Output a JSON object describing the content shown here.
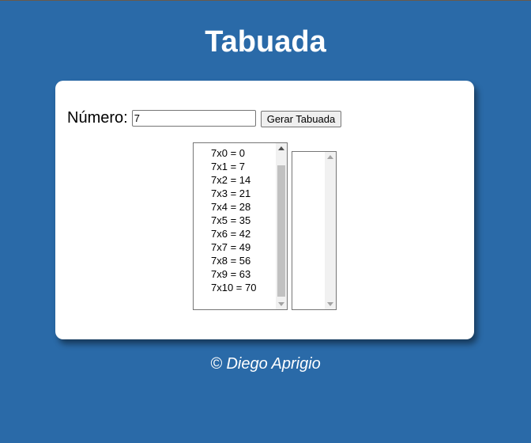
{
  "page": {
    "title": "Tabuada",
    "footer": "© Diego Aprigio"
  },
  "form": {
    "number_label": "Número:",
    "number_value": "7",
    "generate_button": "Gerar Tabuada"
  },
  "table_list": {
    "items": [
      "7x0 = 0",
      "7x1 = 7",
      "7x2 = 14",
      "7x3 = 21",
      "7x4 = 28",
      "7x5 = 35",
      "7x6 = 42",
      "7x7 = 49",
      "7x8 = 56",
      "7x9 = 63",
      "7x10 = 70"
    ]
  },
  "second_list": {
    "items": []
  },
  "colors": {
    "background": "#2a6aa8",
    "card": "#ffffff",
    "text_on_background": "#ffffff"
  }
}
